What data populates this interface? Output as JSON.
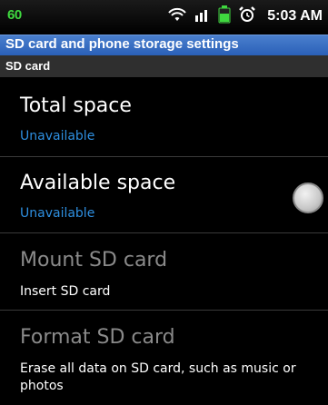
{
  "status_bar": {
    "battery_percent": "60",
    "time": "5:03 AM",
    "icons": [
      "wifi-icon",
      "signal-icon",
      "battery-icon",
      "alarm-icon"
    ],
    "colors": {
      "battery_text": "#3fd83f",
      "battery_icon": "#3fd83f"
    }
  },
  "title_bar": {
    "title": "SD card and phone storage settings",
    "color": "#3a6fc4"
  },
  "section": {
    "header": "SD card"
  },
  "rows": [
    {
      "title": "Total space",
      "subtitle": "Unavailable",
      "enabled": true
    },
    {
      "title": "Available space",
      "subtitle": "Unavailable",
      "enabled": true
    },
    {
      "title": "Mount SD card",
      "subtitle": "Insert SD card",
      "enabled": false
    },
    {
      "title": "Format SD card",
      "subtitle": "Erase all data on SD card, such as music or photos",
      "enabled": false
    }
  ],
  "colors": {
    "accent_blue": "#2e8fe0",
    "disabled_text": "#8a8a8a"
  }
}
